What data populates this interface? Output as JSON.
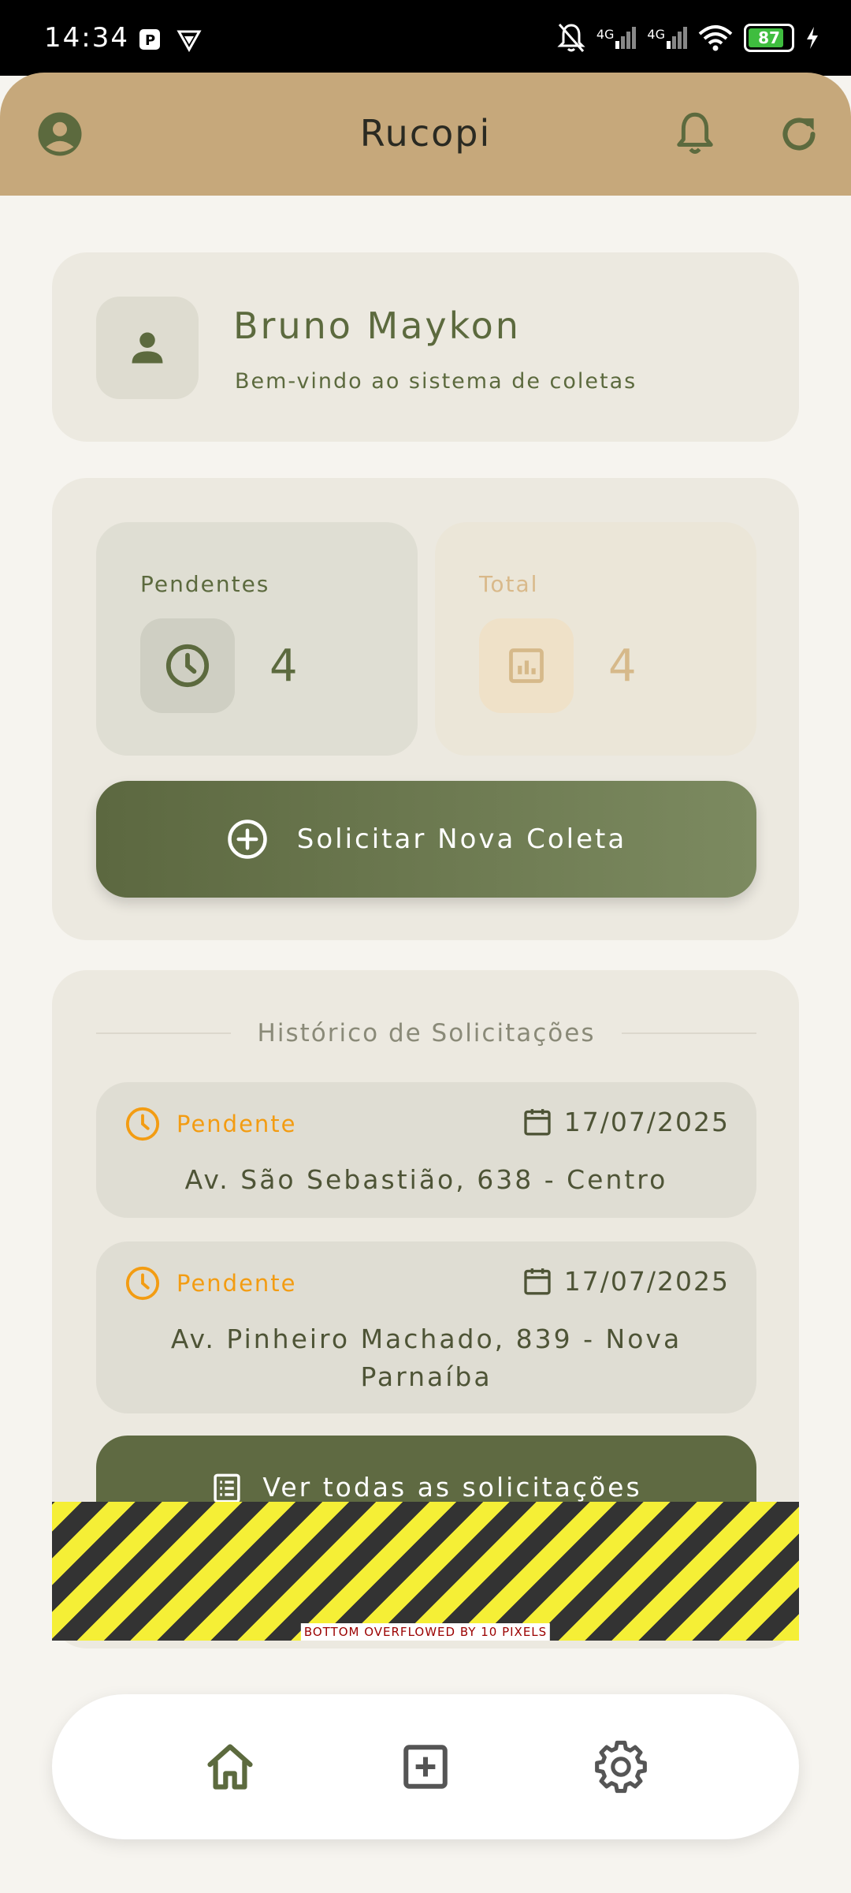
{
  "status_bar": {
    "time": "14:34",
    "network_1": "4G",
    "network_2": "4G",
    "battery": "87",
    "icons": [
      "parking-icon",
      "vpn-icon",
      "mute-bell-icon",
      "signal-icon",
      "wifi-icon",
      "battery-icon",
      "charging-icon"
    ]
  },
  "app_bar": {
    "title": "Rucopi",
    "background": "#c6a87b",
    "left_icon": "account-circle-icon",
    "right_icons": [
      "bell-icon",
      "refresh-icon"
    ]
  },
  "welcome": {
    "name": "Bruno Maykon",
    "subtitle": "Bem-vindo ao sistema de coletas",
    "icon": "person-icon"
  },
  "stats": {
    "pending": {
      "label": "Pendentes",
      "value": "4",
      "icon": "clock-icon"
    },
    "total": {
      "label": "Total",
      "value": "4",
      "icon": "chart-icon"
    }
  },
  "new_request_button": {
    "label": "Solicitar Nova Coleta",
    "icon": "add-circle-icon"
  },
  "history": {
    "title": "Histórico de Solicitações",
    "items": [
      {
        "status": "Pendente",
        "date": "17/07/2025",
        "address": "Av. São Sebastião, 638 - Centro"
      },
      {
        "status": "Pendente",
        "date": "17/07/2025",
        "address": "Av. Pinheiro Machado, 839 - Nova Parnaíba"
      }
    ],
    "view_all_label": "Ver todas as solicitações"
  },
  "overflow_warning": "BOTTOM OVERFLOWED BY 10 PIXELS",
  "bottom_nav": {
    "items": [
      {
        "name": "home",
        "icon": "home-icon"
      },
      {
        "name": "add",
        "icon": "add-box-icon"
      },
      {
        "name": "settings",
        "icon": "gear-icon"
      }
    ]
  },
  "colors": {
    "accent_olive": "#5c6a3e",
    "pending_orange": "#f39c12",
    "app_bar": "#c6a87b",
    "total_tan": "#d6b98a"
  }
}
